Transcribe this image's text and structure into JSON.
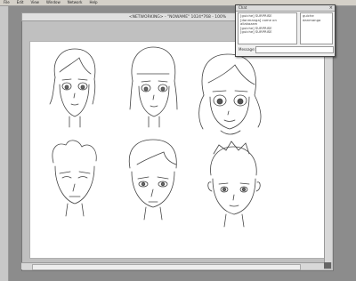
{
  "menu": [
    "File",
    "Edit",
    "View",
    "Window",
    "Network",
    "Help"
  ],
  "canvas": {
    "title": "<NETWORKING> - \"NOWAME\" 1024*768 - 100%"
  },
  "chat": {
    "title": "Chat",
    "log": [
      "[guiche] SURPRISE",
      "[danmanga] come on allakazam",
      "[guiche] SURPRISE",
      "[guiche] SURPRISE"
    ],
    "users": [
      "guiche",
      "danmanga"
    ],
    "message_label": "Message:",
    "message_value": ""
  }
}
